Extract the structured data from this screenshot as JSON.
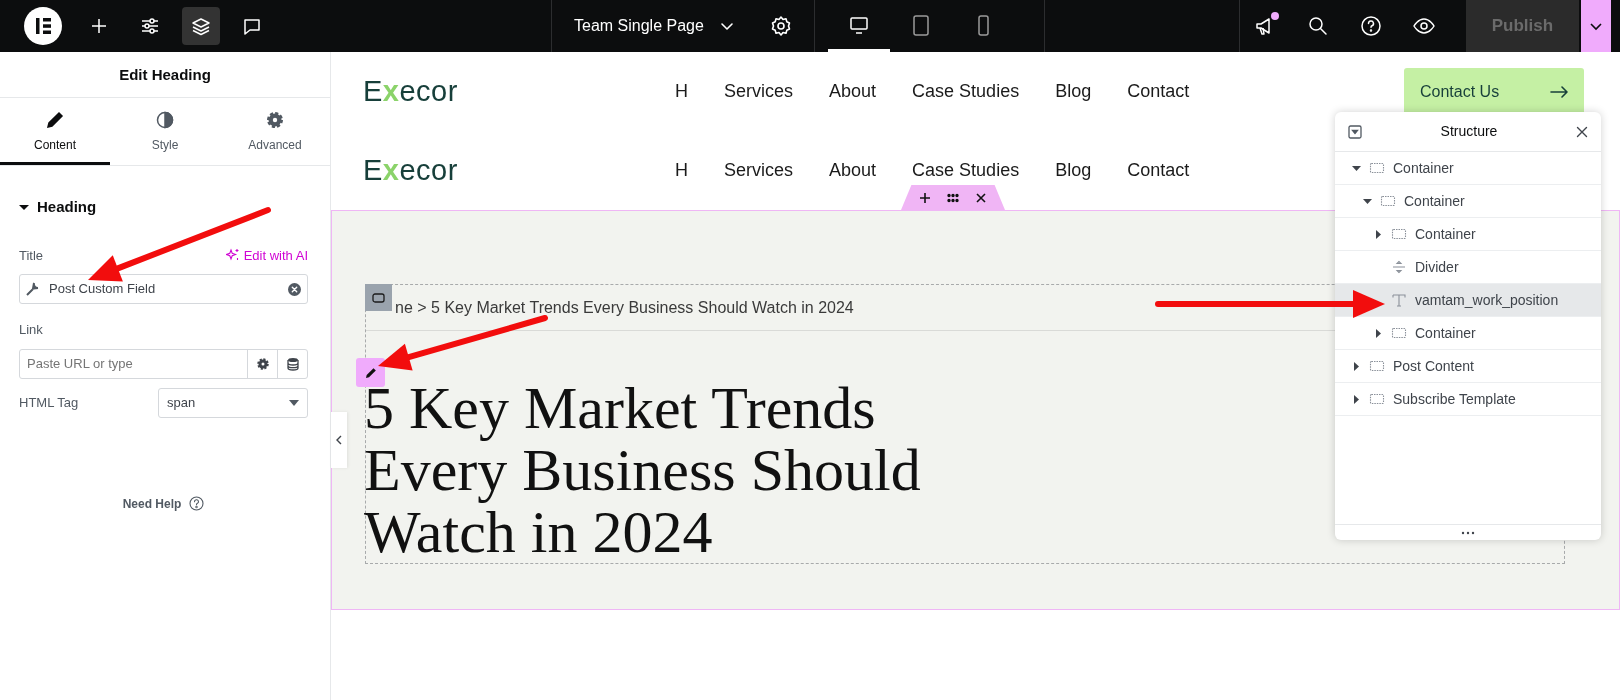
{
  "topbar": {
    "tools": [
      {
        "kind": "add",
        "selected": false
      },
      {
        "kind": "settings",
        "selected": false
      },
      {
        "kind": "structure",
        "selected": true
      },
      {
        "kind": "comments",
        "selected": false
      }
    ],
    "document_title": "Team Single Page",
    "devices": [
      {
        "kind": "desktop",
        "selected": true
      },
      {
        "kind": "tablet",
        "selected": false
      },
      {
        "kind": "mobile",
        "selected": false
      }
    ],
    "notification": true,
    "publish": {
      "label": "Publish",
      "disabled": true
    }
  },
  "panel": {
    "title": "Edit Heading",
    "tabs": [
      {
        "label": "Content",
        "kind": "pencil",
        "selected": true
      },
      {
        "label": "Style",
        "kind": "contrast",
        "selected": false
      },
      {
        "label": "Advanced",
        "kind": "gear",
        "selected": false
      }
    ],
    "section": {
      "title": "Heading",
      "expanded": true
    },
    "title_field": {
      "label": "Title",
      "ai_link": "Edit with AI",
      "value": "Post Custom Field"
    },
    "link_field": {
      "label": "Link",
      "placeholder": "Paste URL or type"
    },
    "tag_field": {
      "label": "HTML Tag",
      "value": "span"
    },
    "help": "Need Help"
  },
  "site": {
    "headers": [
      {
        "logo": {
          "before": "E",
          "mark": "x",
          "after": "ecor"
        },
        "nav": [
          "H",
          "Services",
          "About",
          "Case Studies",
          "Blog",
          "Contact"
        ],
        "cta": "Contact Us"
      },
      {
        "logo": {
          "before": "E",
          "mark": "x",
          "after": "ecor"
        },
        "nav": [
          "H",
          "Services",
          "About",
          "Case Studies",
          "Blog",
          "Contact"
        ]
      }
    ]
  },
  "page": {
    "breadcrumb": "ne > 5 Key Market Trends Every Business Should Watch in 2024",
    "heading_lines": [
      "5 Key Market Trends",
      "Every Business Should",
      "Watch in 2024"
    ]
  },
  "structure": {
    "title": "Structure",
    "items": [
      {
        "label": "Container",
        "kind": "container",
        "expanded": true,
        "selected": false,
        "children": [
          {
            "label": "Container",
            "kind": "container",
            "expanded": true,
            "selected": false,
            "children": [
              {
                "label": "Container",
                "kind": "container",
                "expanded": false,
                "selected": false
              },
              {
                "label": "Divider",
                "kind": "divider",
                "selected": false
              },
              {
                "label": "vamtam_work_position",
                "kind": "text",
                "selected": true
              },
              {
                "label": "Container",
                "kind": "container",
                "expanded": false,
                "selected": false
              }
            ]
          }
        ]
      },
      {
        "label": "Post Content",
        "kind": "container",
        "expanded": false,
        "selected": false
      },
      {
        "label": "Subscribe Template",
        "kind": "container",
        "expanded": false,
        "selected": false
      }
    ]
  }
}
